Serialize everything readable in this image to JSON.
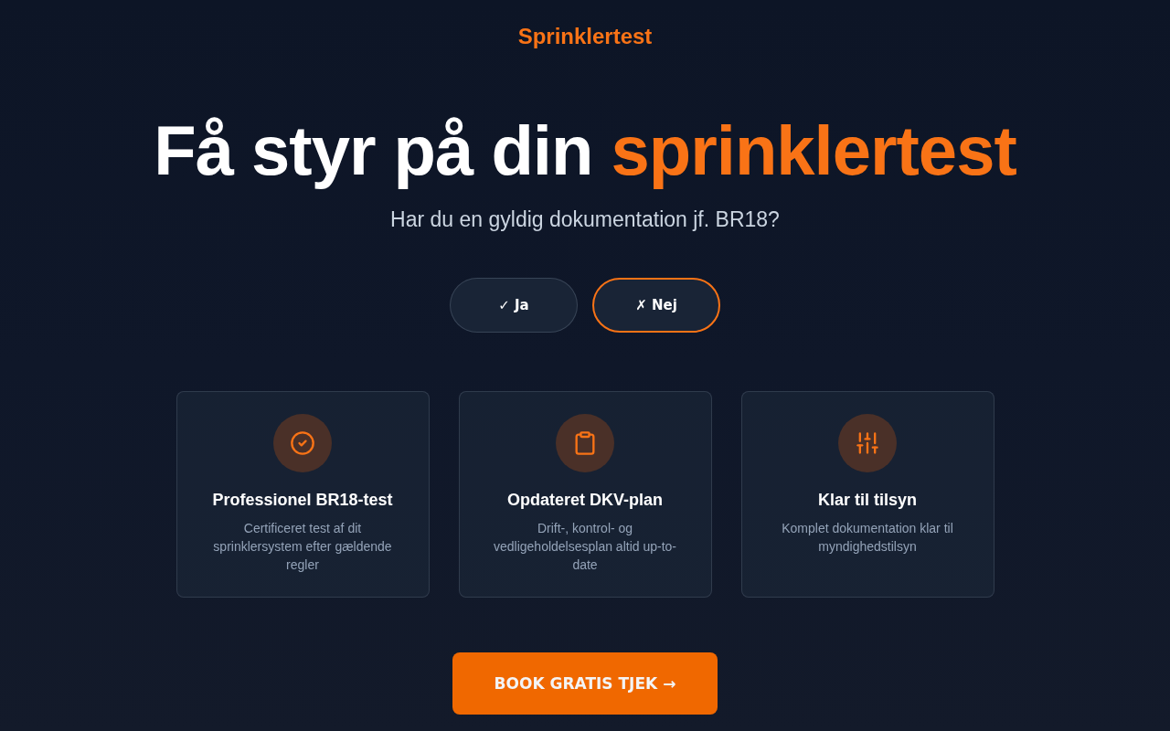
{
  "brand": {
    "name": "Sprinklertest"
  },
  "hero": {
    "headline": {
      "text": "Få styr på din",
      "highlight": "sprinklertest"
    },
    "subtitle": "Har du en gyldig dokumentation jf. BR18?"
  },
  "options": [
    {
      "label": "✓ Ja",
      "selected": false
    },
    {
      "label": "✗ Nej",
      "selected": true
    }
  ],
  "features": [
    {
      "title": "Professionel BR18-test",
      "description": "Certificeret test af dit sprinklersystem efter gældende regler"
    },
    {
      "title": "Opdateret DKV-plan",
      "description": "Drift-, kontrol- og vedligeholdelsesplan altid up-to-date"
    },
    {
      "title": "Klar til tilsyn",
      "description": "Komplet dokumentation klar til myndighedstilsyn"
    }
  ],
  "cta": {
    "label": "BOOK GRATIS TJEK →"
  }
}
